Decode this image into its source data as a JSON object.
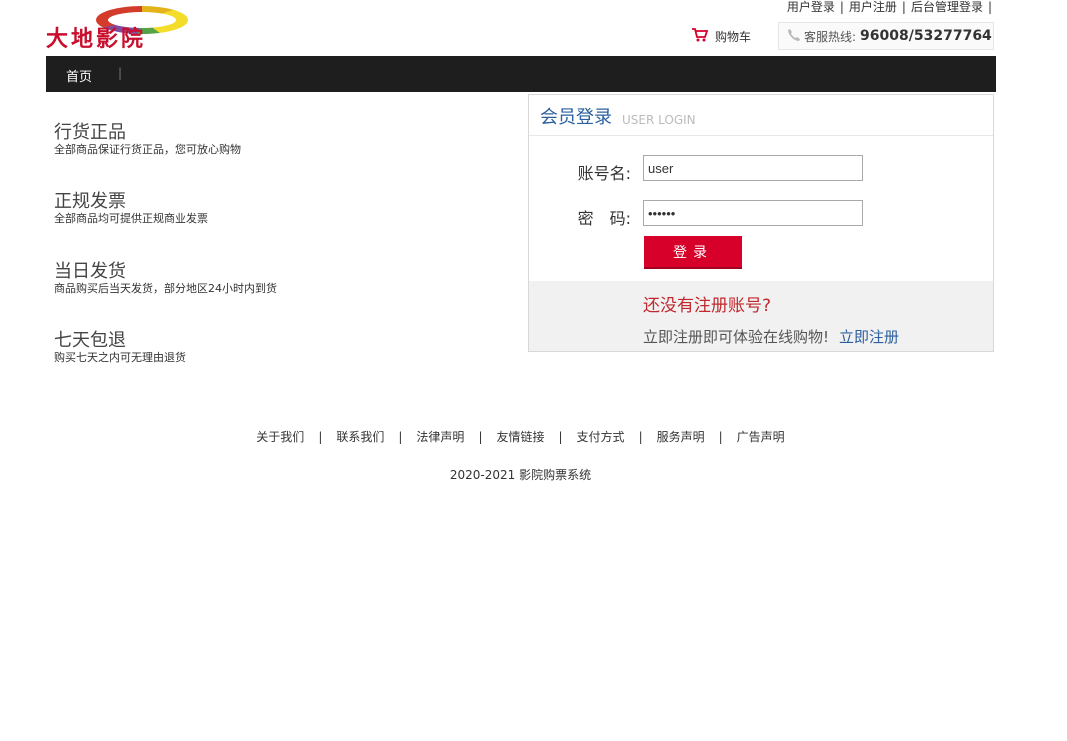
{
  "header": {
    "logo_text": "大地影院",
    "top_links": [
      "用户登录",
      "用户注册",
      "后台管理登录"
    ],
    "cart_label": "购物车",
    "hotline_label": "客服热线:",
    "hotline_number": "96008/53277764"
  },
  "nav": {
    "home": "首页",
    "sep": "|"
  },
  "features": [
    {
      "title": "行货正品",
      "desc": "全部商品保证行货正品，您可放心购物"
    },
    {
      "title": "正规发票",
      "desc": "全部商品均可提供正规商业发票"
    },
    {
      "title": "当日发货",
      "desc": "商品购买后当天发货，部分地区24小时内到货"
    },
    {
      "title": "七天包退",
      "desc": "购买七天之内可无理由退货"
    }
  ],
  "login": {
    "title": "会员登录",
    "subtitle": "USER LOGIN",
    "account_label": "账号名:",
    "account_value": "user",
    "password_label": "密　码:",
    "password_value": "••••••",
    "submit": "登录",
    "no_account": "还没有注册账号?",
    "register_text": "立即注册即可体验在线购物!",
    "register_link": "立即注册"
  },
  "footer": {
    "links": [
      "关于我们",
      "联系我们",
      "法律声明",
      "友情链接",
      "支付方式",
      "服务声明",
      "广告声明"
    ],
    "sep": "|",
    "copyright": "2020-2021 影院购票系统"
  },
  "colors": {
    "brand_red": "#d6002a",
    "nav_bg": "#1e1e1e",
    "link_blue": "#2b5f9e"
  }
}
